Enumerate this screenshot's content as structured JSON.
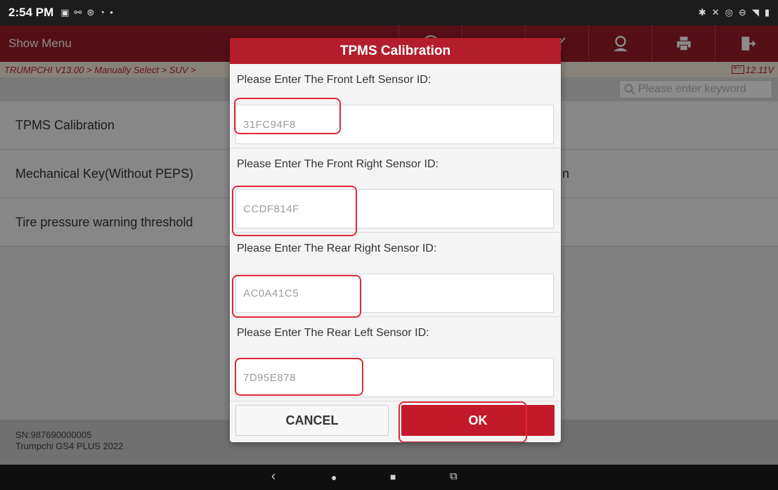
{
  "status_bar": {
    "time": "2:54 PM",
    "left_icons": [
      "message-icon",
      "usb-icon",
      "accessibility-icon",
      "wifi-icon",
      "dot-icon"
    ],
    "right_icons": [
      "bluetooth-icon",
      "mute-icon",
      "location-icon",
      "dnd-icon",
      "signal-icon",
      "battery-icon"
    ]
  },
  "toolbar": {
    "show_menu": "Show Menu",
    "tools": [
      "help-icon",
      "upload-icon",
      "edit-icon",
      "user-icon",
      "print-icon",
      "exit-icon"
    ]
  },
  "breadcrumb": {
    "path": "TRUMPCHI V13.00 > Manually Select > SUV >",
    "voltage": "12.11V"
  },
  "search": {
    "placeholder": "Please enter keyword"
  },
  "list": {
    "items": [
      {
        "label": "TPMS Calibration",
        "right": ""
      },
      {
        "label": "Mechanical Key(Without PEPS)",
        "right": "n"
      },
      {
        "label": "Tire pressure warning threshold",
        "right": ""
      }
    ]
  },
  "footer": {
    "sn": "SN:987690000005",
    "vehicle": "Trumpchi GS4 PLUS 2022"
  },
  "dialog": {
    "title": "TPMS Calibration",
    "fields": [
      {
        "label": "Please Enter The Front Left Sensor ID:",
        "value": "31FC94F8"
      },
      {
        "label": "Please Enter The Front Right Sensor ID:",
        "value": "CCDF814F"
      },
      {
        "label": "Please Enter The Rear Right Sensor ID:",
        "value": "AC0A41C5"
      },
      {
        "label": "Please Enter The Rear Left Sensor ID:",
        "value": "7D95E878"
      }
    ],
    "cancel_label": "CANCEL",
    "ok_label": "OK"
  },
  "colors": {
    "brand_red": "#b31d2c",
    "highlight": "#e0283a"
  }
}
